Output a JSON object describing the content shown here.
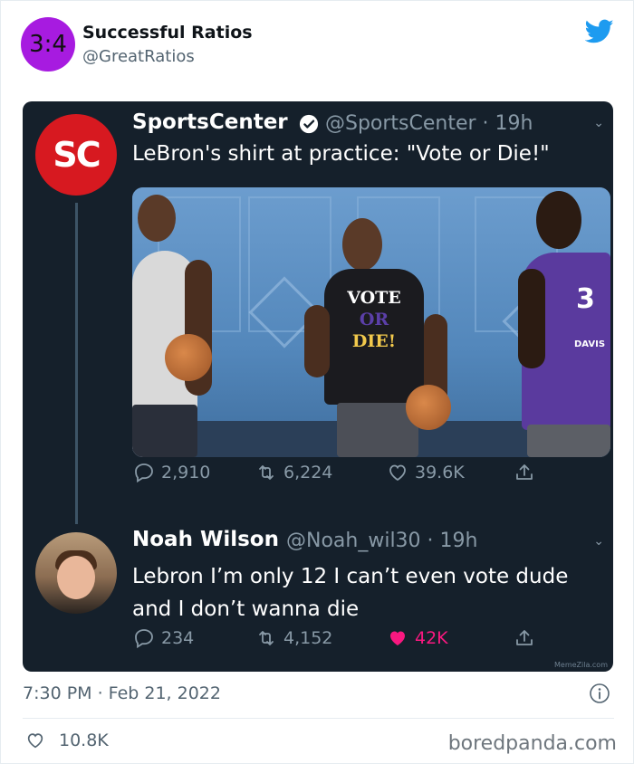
{
  "tweet": {
    "author": {
      "avatar_text": "3:4",
      "name": "Successful Ratios",
      "handle": "@GreatRatios"
    },
    "timestamp": "7:30 PM · Feb 21, 2022",
    "likes": "10.8K"
  },
  "embedded": {
    "original": {
      "avatar_text": "SC",
      "name": "SportsCenter",
      "handle": "@SportsCenter · 19h",
      "text": "LeBron's shirt at practice: \"Vote or Die!\"",
      "photo": {
        "shirt_line1": "VOTE",
        "shirt_line2": "OR",
        "shirt_line3": "DIE!",
        "jersey_number": "3",
        "jersey_name": "DAVIS"
      },
      "replies": "2,910",
      "retweets": "6,224",
      "likes": "39.6K"
    },
    "reply": {
      "name": "Noah Wilson",
      "handle": "@Noah_wil30 · 19h",
      "text": "Lebron I’m only 12 I can’t even vote dude and I don’t wanna die",
      "replies": "234",
      "retweets": "4,152",
      "likes": "42K"
    },
    "watermark": "MemeZila.com"
  },
  "site_credit": "boredpanda.com",
  "colors": {
    "avatar_bg": "#a71be0",
    "twitter_blue": "#1d9bf0",
    "sportscenter_red": "#d71920",
    "dark_bg": "#15202b",
    "like_pink": "#f91880"
  }
}
